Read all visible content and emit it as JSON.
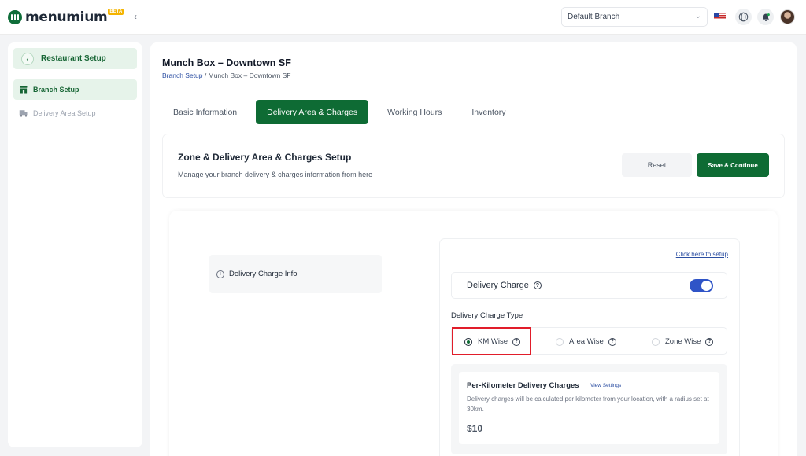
{
  "app": {
    "name": "menumium",
    "badge": "BETA"
  },
  "topbar": {
    "branch_select": "Default Branch",
    "icons": [
      "us-flag-icon",
      "globe-icon",
      "bell-icon",
      "avatar"
    ]
  },
  "sidebar": {
    "header": "Restaurant Setup",
    "items": [
      {
        "label": "Branch Setup",
        "icon": "store-icon",
        "active": true
      },
      {
        "label": "Delivery Area Setup",
        "icon": "truck-icon",
        "active": false
      }
    ]
  },
  "page": {
    "title": "Munch Box – Downtown SF",
    "breadcrumb_link": "Branch Setup",
    "breadcrumb_sep": " / ",
    "breadcrumb_current": "Munch Box – Downtown SF"
  },
  "tabs": [
    {
      "label": "Basic Information"
    },
    {
      "label": "Delivery Area & Charges",
      "active": true
    },
    {
      "label": "Working Hours"
    },
    {
      "label": "Inventory"
    }
  ],
  "section": {
    "title": "Zone & Delivery Area & Charges Setup",
    "subtitle": "Manage your branch delivery & charges information from here",
    "reset_label": "Reset",
    "save_label": "Save & Continue"
  },
  "content": {
    "info_label": "Delivery Charge Info",
    "setup_link": "Click here to setup",
    "delivery_charge_label": "Delivery Charge",
    "delivery_charge_enabled": true,
    "type_label": "Delivery Charge Type",
    "types": [
      {
        "label": "KM Wise",
        "selected": true
      },
      {
        "label": "Area Wise",
        "selected": false
      },
      {
        "label": "Zone Wise",
        "selected": false
      }
    ],
    "per_km": {
      "title": "Per-Kilometer Delivery Charges",
      "view_settings": "View Settings",
      "description": "Delivery charges will be calculated per kilometer from your location, with a radius set at 30km.",
      "amount": "$10"
    }
  },
  "colors": {
    "brand": "#0e6b34",
    "accent_blue": "#2f54c7",
    "highlight": "#e11d2a"
  }
}
